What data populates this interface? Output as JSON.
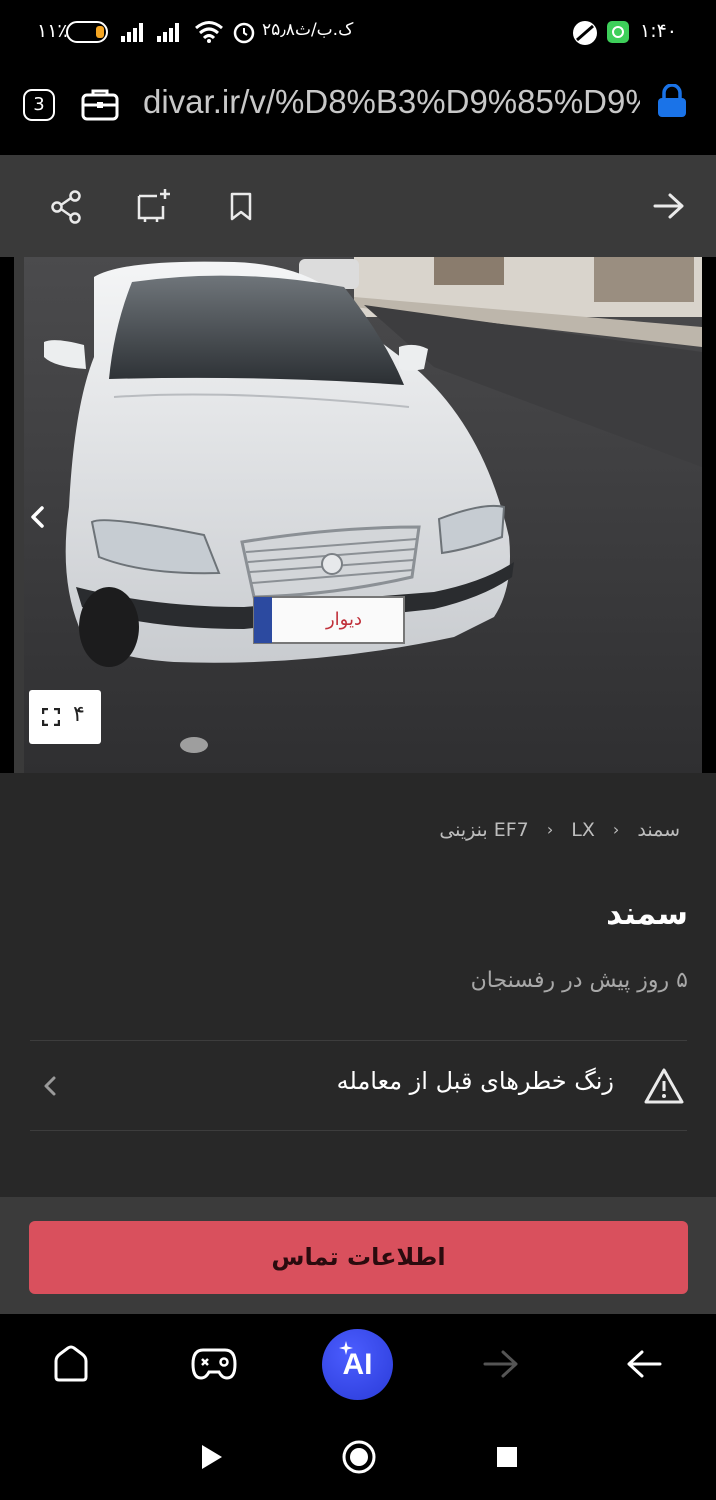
{
  "status_bar": {
    "time": "۱:۴۰",
    "battery": "۱۱٪",
    "network_speed": "۲۵٫۸ک.ب/ث"
  },
  "browser": {
    "url": "divar.ir/v/%D8%B3%D9%85%D9%",
    "tab_count": "3"
  },
  "toolbar": {
    "icons": [
      "share-icon",
      "add-note-icon",
      "bookmark-icon",
      "forward-arrow-icon"
    ]
  },
  "gallery": {
    "photo_count": "۴",
    "plate_text": "دیوار"
  },
  "listing": {
    "breadcrumb": [
      "سمند",
      "LX",
      "EF7 بنزینی"
    ],
    "title": "سمند",
    "subtitle": "۵ روز پیش در رفسنجان",
    "warning_label": "زنگ خطرهای قبل از معامله",
    "contact_label": "اطلاعات تماس"
  },
  "browser_nav": {
    "ai_label": "AI"
  },
  "colors": {
    "accent": "#d9505d",
    "page_bg": "#282828",
    "toolbar_bg": "#3a3a3a",
    "lock": "#1a73e8"
  }
}
